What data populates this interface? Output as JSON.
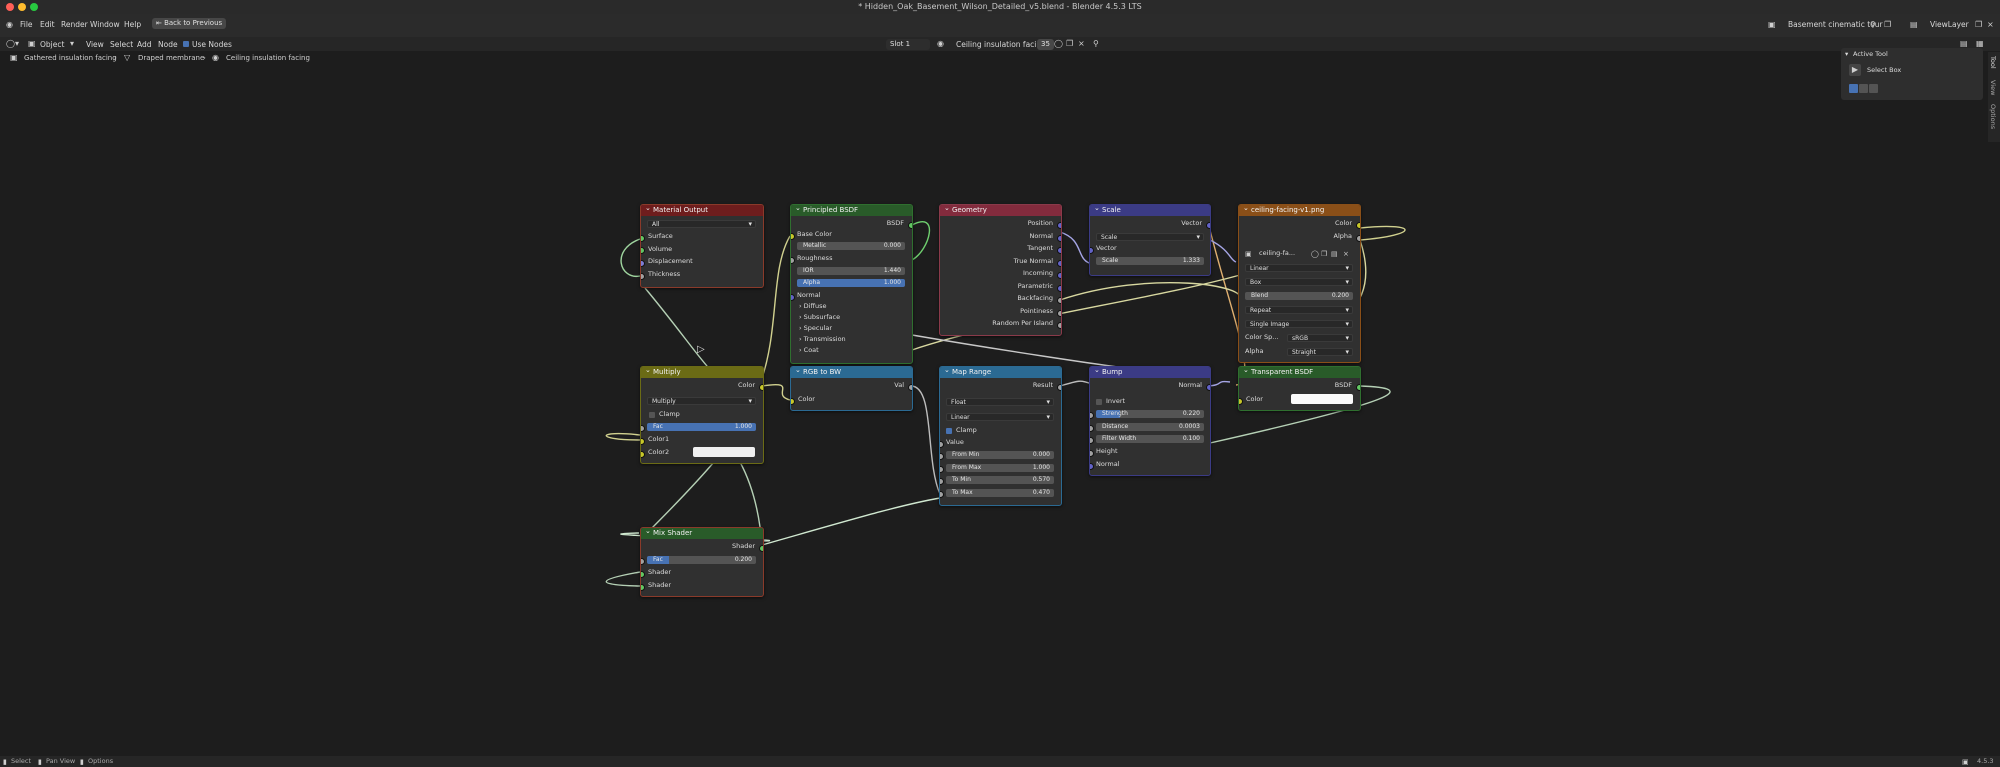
{
  "window": {
    "title": "* Hidden_Oak_Basement_Wilson_Detailed_v5.blend - Blender 4.5.3 LTS"
  },
  "menu": {
    "items": [
      "File",
      "Edit",
      "Render",
      "Window",
      "Help"
    ],
    "back_button": "Back to Previous"
  },
  "workspace": {
    "scene_label": "Basement cinematic tour",
    "viewlayer_label": "ViewLayer"
  },
  "header": {
    "mode": "Object",
    "menus": [
      "View",
      "Select",
      "Add",
      "Node"
    ],
    "use_nodes": "Use Nodes",
    "slot": "Slot 1",
    "material_name": "Ceiling insulation facing",
    "users": "35"
  },
  "breadcrumb": [
    "Gathered insulation facing",
    "Draped membrane",
    "Ceiling insulation facing"
  ],
  "side_tabs": [
    "Tool",
    "View",
    "Options"
  ],
  "tool_panel": {
    "title": "Active Tool",
    "tool": "Select Box"
  },
  "nodes": {
    "material_output": {
      "title": "Material Output",
      "target": "All",
      "inputs": [
        "Surface",
        "Volume",
        "Displacement",
        "Thickness"
      ]
    },
    "principled": {
      "title": "Principled BSDF",
      "output": "BSDF",
      "base_color": "Base Color",
      "metallic_label": "Metallic",
      "metallic": "0.000",
      "roughness": "Roughness",
      "ior_label": "IOR",
      "ior": "1.440",
      "alpha_label": "Alpha",
      "alpha": "1.000",
      "normal": "Normal",
      "panels": [
        "Diffuse",
        "Subsurface",
        "Specular",
        "Transmission",
        "Coat"
      ]
    },
    "geometry": {
      "title": "Geometry",
      "outputs": [
        "Position",
        "Normal",
        "Tangent",
        "True Normal",
        "Incoming",
        "Parametric",
        "Backfacing",
        "Pointiness",
        "Random Per Island"
      ]
    },
    "scale": {
      "title": "Scale",
      "output": "Vector",
      "mode": "Scale",
      "input": "Vector",
      "scale_label": "Scale",
      "scale": "1.333"
    },
    "image": {
      "title": "ceiling-facing-v1.png",
      "outputs": [
        "Color",
        "Alpha"
      ],
      "image_name": "ceiling-fa...",
      "interpolation": "Linear",
      "projection": "Box",
      "blend_label": "Blend",
      "blend": "0.200",
      "extension": "Repeat",
      "source": "Single Image",
      "colorspace_label": "Color Sp...",
      "colorspace": "sRGB",
      "alpha_label": "Alpha",
      "alpha": "Straight"
    },
    "multiply": {
      "title": "Multiply",
      "output": "Color",
      "blend_mode": "Multiply",
      "clamp": "Clamp",
      "fac_label": "Fac",
      "fac": "1.000",
      "color1": "Color1",
      "color2": "Color2"
    },
    "rgb_to_bw": {
      "title": "RGB to BW",
      "output": "Val",
      "input": "Color"
    },
    "map_range": {
      "title": "Map Range",
      "output": "Result",
      "data_type": "Float",
      "interpolation": "Linear",
      "clamp": "Clamp",
      "value": "Value",
      "from_min_label": "From Min",
      "from_min": "0.000",
      "from_max_label": "From Max",
      "from_max": "1.000",
      "to_min_label": "To Min",
      "to_min": "0.570",
      "to_max_label": "To Max",
      "to_max": "0.470"
    },
    "bump": {
      "title": "Bump",
      "output": "Normal",
      "invert": "Invert",
      "strength_label": "Strength",
      "strength": "0.220",
      "distance_label": "Distance",
      "distance": "0.0003",
      "filter_label": "Filter Width",
      "filter": "0.100",
      "height": "Height",
      "normal": "Normal"
    },
    "transparent": {
      "title": "Transparent BSDF",
      "output": "BSDF",
      "input": "Color"
    },
    "mix_shader": {
      "title": "Mix Shader",
      "output": "Shader",
      "fac_label": "Fac",
      "fac": "0.200",
      "shader1": "Shader",
      "shader2": "Shader"
    }
  },
  "status": {
    "items": [
      "Select",
      "Pan View",
      "Options"
    ],
    "version": "4.5.3"
  },
  "colors": {
    "accent": "#4772b3",
    "output_header": "#6e1d1d",
    "shader_header": "#295b29",
    "input_header": "#832b3d",
    "vector_header": "#3b3b85",
    "texture_header": "#8a4f18",
    "color_header": "#6b6b15",
    "converter_header": "#2b6a93"
  }
}
